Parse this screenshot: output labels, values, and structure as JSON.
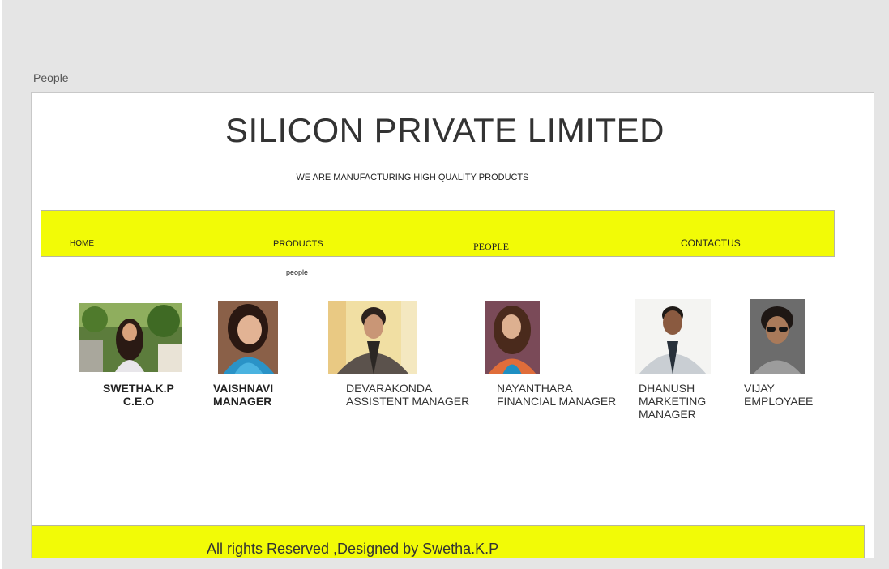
{
  "window": {
    "tab_title": "People"
  },
  "header": {
    "title": "SILICON PRIVATE LIMITED",
    "tagline": "WE ARE MANUFACTURING HIGH QUALITY PRODUCTS"
  },
  "nav": {
    "home": "HOME",
    "products": "PRODUCTS",
    "people": "PEOPLE",
    "contact": "CONTACTUS"
  },
  "section": {
    "label": "people"
  },
  "people": [
    {
      "name": "SWETHA.K.P",
      "role": "C.E.O"
    },
    {
      "name": "VAISHNAVI",
      "role": "MANAGER"
    },
    {
      "name": "DEVARAKONDA",
      "role": "ASSISTENT MANAGER"
    },
    {
      "name": "NAYANTHARA",
      "role": "FINANCIAL MANAGER"
    },
    {
      "name": "DHANUSH",
      "role_line1": "MARKETING",
      "role_line2": "MANAGER"
    },
    {
      "name": "VIJAY",
      "role": "EMPLOYAEE"
    }
  ],
  "footer": {
    "text": "All rights Reserved ,Designed by Swetha.K.P"
  },
  "colors": {
    "nav_bg": "#f2fb06",
    "page_bg": "#e5e5e5",
    "text": "#333333"
  }
}
